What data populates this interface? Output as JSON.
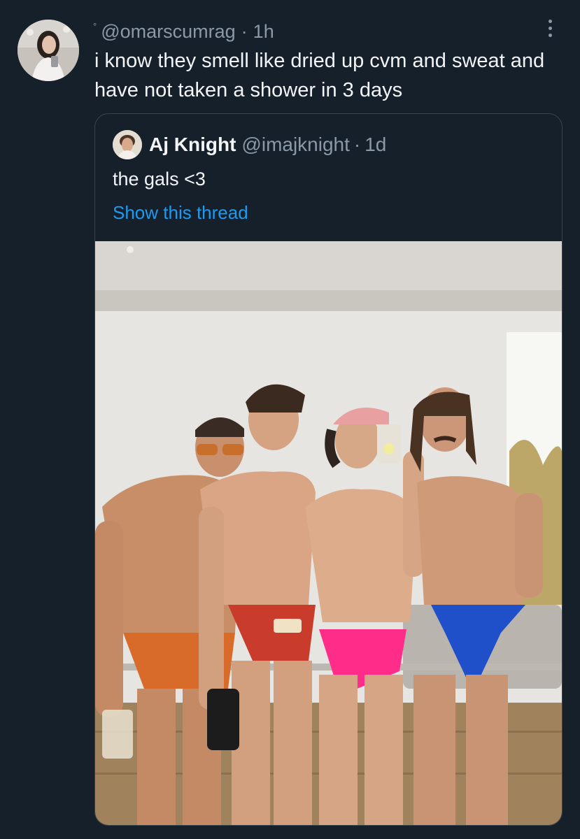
{
  "tweet": {
    "handle": "@omarscumrag",
    "time": "1h",
    "separator": "·",
    "text": "i know they smell like dried up cvm and sweat and have not taken a shower in 3 days",
    "more_icon": "more-vertical-icon"
  },
  "quote": {
    "name": "Aj Knight",
    "handle": "@imajknight",
    "separator": "·",
    "time": "1d",
    "text": "the gals <3",
    "show_thread": "Show this thread"
  },
  "colors": {
    "background": "#16202b",
    "border": "#38444d",
    "muted_text": "#8b98a5",
    "link": "#1d9bf0",
    "primary_text": "#f2f4f5"
  }
}
